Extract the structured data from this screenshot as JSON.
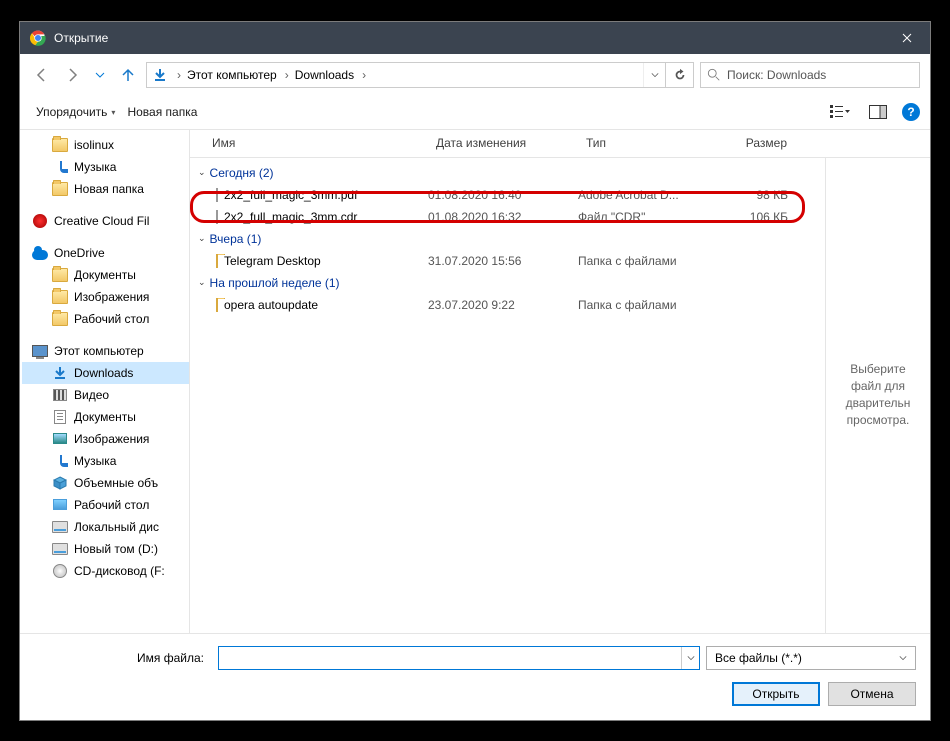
{
  "window": {
    "title": "Открытие"
  },
  "nav": {
    "crumb1": "Этот компьютер",
    "crumb2": "Downloads"
  },
  "search": {
    "placeholder": "Поиск: Downloads"
  },
  "toolbar": {
    "organize": "Упорядочить",
    "newfolder": "Новая папка"
  },
  "columns": {
    "name": "Имя",
    "date": "Дата изменения",
    "type": "Тип",
    "size": "Размер"
  },
  "sidebar": {
    "items": [
      {
        "label": "isolinux",
        "icon": "folder",
        "lvl": "l2"
      },
      {
        "label": "Музыка",
        "icon": "music",
        "lvl": "l2"
      },
      {
        "label": "Новая папка",
        "icon": "folder",
        "lvl": "l2"
      },
      {
        "gap": true
      },
      {
        "label": "Creative Cloud Fil",
        "icon": "cc",
        "lvl": "l1"
      },
      {
        "gap": true
      },
      {
        "label": "OneDrive",
        "icon": "cloud",
        "lvl": "l1"
      },
      {
        "label": "Документы",
        "icon": "folder",
        "lvl": "l2"
      },
      {
        "label": "Изображения",
        "icon": "folder",
        "lvl": "l2"
      },
      {
        "label": "Рабочий стол",
        "icon": "folder",
        "lvl": "l2"
      },
      {
        "gap": true
      },
      {
        "label": "Этот компьютер",
        "icon": "pc",
        "lvl": "l1"
      },
      {
        "label": "Downloads",
        "icon": "dl",
        "lvl": "l2",
        "selected": true
      },
      {
        "label": "Видео",
        "icon": "vid",
        "lvl": "l2"
      },
      {
        "label": "Документы",
        "icon": "doc",
        "lvl": "l2"
      },
      {
        "label": "Изображения",
        "icon": "pic",
        "lvl": "l2"
      },
      {
        "label": "Музыка",
        "icon": "music",
        "lvl": "l2"
      },
      {
        "label": "Объемные объ",
        "icon": "cube",
        "lvl": "l2"
      },
      {
        "label": "Рабочий стол",
        "icon": "desk",
        "lvl": "l2"
      },
      {
        "label": "Локальный дис",
        "icon": "disk",
        "lvl": "l2"
      },
      {
        "label": "Новый том (D:)",
        "icon": "disk",
        "lvl": "l2"
      },
      {
        "label": "CD-дисковод (F:",
        "icon": "cd",
        "lvl": "l2"
      }
    ]
  },
  "groups": [
    {
      "label": "Сегодня (2)",
      "rows": [
        {
          "name": "2x2_full_magic_3mm.pdf",
          "date": "01.08.2020 16:40",
          "type": "Adobe Acrobat D...",
          "size": "98 КБ",
          "icon": "pdf"
        },
        {
          "name": "2x2_full_magic_3mm.cdr",
          "date": "01.08.2020 16:32",
          "type": "Файл \"CDR\"",
          "size": "106 КБ",
          "icon": "cdr"
        }
      ]
    },
    {
      "label": "Вчера (1)",
      "rows": [
        {
          "name": "Telegram Desktop",
          "date": "31.07.2020 15:56",
          "type": "Папка с файлами",
          "size": "",
          "icon": "folder"
        }
      ]
    },
    {
      "label": "На прошлой неделе (1)",
      "rows": [
        {
          "name": "opera autoupdate",
          "date": "23.07.2020 9:22",
          "type": "Папка с файлами",
          "size": "",
          "icon": "folder"
        }
      ]
    }
  ],
  "preview": {
    "empty": "Выберите файл для дварительн просмотра."
  },
  "bottom": {
    "filename_label": "Имя файла:",
    "filename_value": "",
    "filter": "Все файлы (*.*)",
    "open": "Открыть",
    "cancel": "Отмена"
  }
}
